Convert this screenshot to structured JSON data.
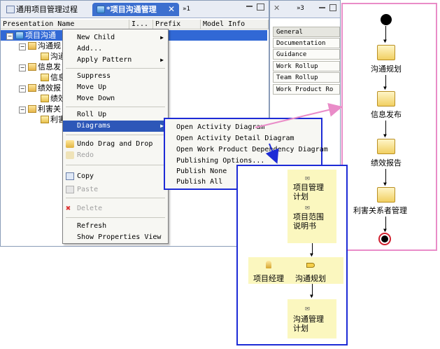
{
  "editor": {
    "tab_process": "通用项目管理过程",
    "tab_activity": "*项目沟通管理",
    "tab_overflow": "»1",
    "columns": [
      "Presentation Name",
      "I...",
      "Prefix",
      "Model Info"
    ],
    "tree": [
      {
        "label": "项目沟通",
        "level": 0,
        "type": "process",
        "selected": true
      },
      {
        "label": "沟通规",
        "level": 1,
        "type": "folder"
      },
      {
        "label": "沟通",
        "level": 2,
        "type": "activity"
      },
      {
        "label": "信息发",
        "level": 1,
        "type": "folder"
      },
      {
        "label": "信息",
        "level": 2,
        "type": "activity"
      },
      {
        "label": "绩效报",
        "level": 1,
        "type": "folder"
      },
      {
        "label": "绩效",
        "level": 2,
        "type": "activity"
      },
      {
        "label": "利害关",
        "level": 1,
        "type": "folder"
      },
      {
        "label": "利害",
        "level": 2,
        "type": "activity"
      }
    ]
  },
  "context_menu": {
    "items": [
      {
        "label": "New Child",
        "submenu": true
      },
      {
        "label": "Add..."
      },
      {
        "label": "Apply Pattern",
        "submenu": true
      },
      {
        "sep": true
      },
      {
        "label": "Suppress"
      },
      {
        "label": "Move Up"
      },
      {
        "label": "Move Down"
      },
      {
        "sep": true
      },
      {
        "label": "Roll Up"
      },
      {
        "label": "Diagrams",
        "submenu": true,
        "highlighted": true
      },
      {
        "sep": true
      },
      {
        "label": "Undo Drag and Drop",
        "icon": "undo-icon"
      },
      {
        "label": "Redo",
        "icon": "redo-icon",
        "disabled": true
      },
      {
        "sep": true
      },
      {
        "label": "Copy",
        "icon": "copy-icon"
      },
      {
        "label": "Paste",
        "icon": "paste-icon",
        "disabled": true
      },
      {
        "sep": true
      },
      {
        "label": "Delete",
        "icon": "delete-icon",
        "disabled": true
      },
      {
        "sep": true
      },
      {
        "label": "Refresh"
      },
      {
        "label": "Show Properties View"
      }
    ]
  },
  "diagrams_submenu": {
    "items": [
      "Open Activity Diagram",
      "Open Activity Detail Diagram",
      "Open Work Product Dependency Diagram",
      "Publishing Options...",
      "Publish None",
      "Publish All"
    ]
  },
  "properties": {
    "tab_overflow": "»3",
    "tabs": [
      "General",
      "Documentation",
      "Guidance",
      "Work Rollup",
      "Team Rollup",
      "Work Product Ro"
    ]
  },
  "activity_diagram": {
    "nodes": [
      "沟通规划",
      "信息发布",
      "绩效报告",
      "利害关系者管理"
    ]
  },
  "detail_diagram": {
    "top_items": [
      "项目管理\n计划",
      "项目范围\n说明书"
    ],
    "role": "项目经理",
    "task": "沟通规划",
    "output": "沟通管理\n计划"
  },
  "colors": {
    "highlight": "#2d57b8",
    "pink_callout": "#e98cc8",
    "blue_callout": "#1d2bd6",
    "artifact_yellow": "#fbf7bf"
  }
}
